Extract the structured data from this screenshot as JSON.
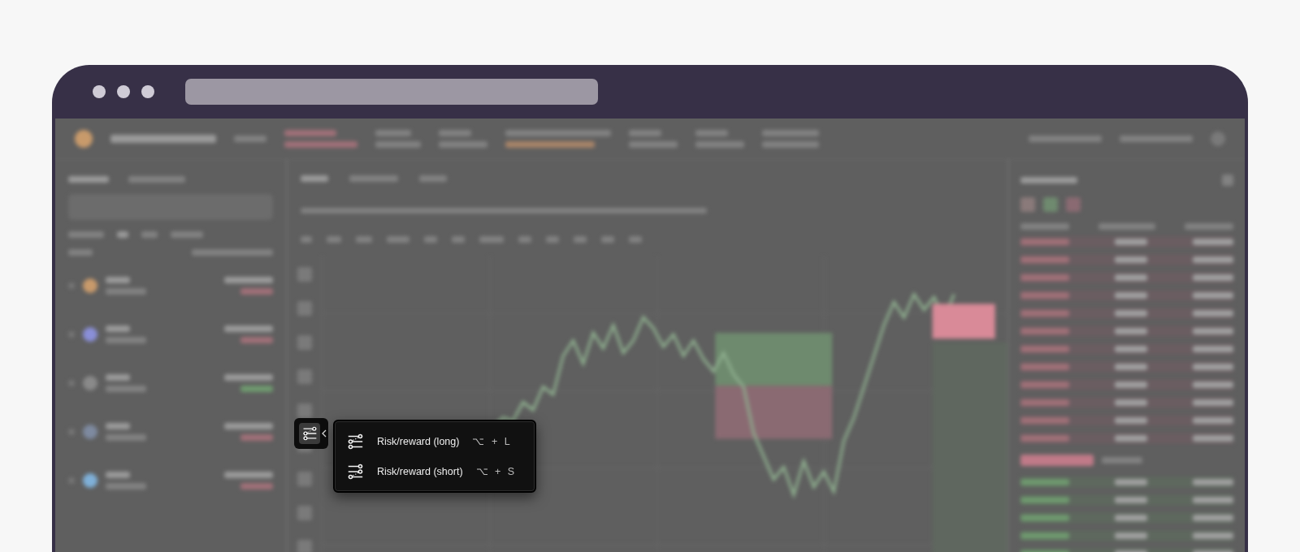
{
  "menu": {
    "items": [
      {
        "kind": "long",
        "label": "Risk/reward (long)",
        "shortcut": "⌥ + L"
      },
      {
        "kind": "short",
        "label": "Risk/reward (short)",
        "shortcut": "⌥ + S"
      }
    ]
  }
}
